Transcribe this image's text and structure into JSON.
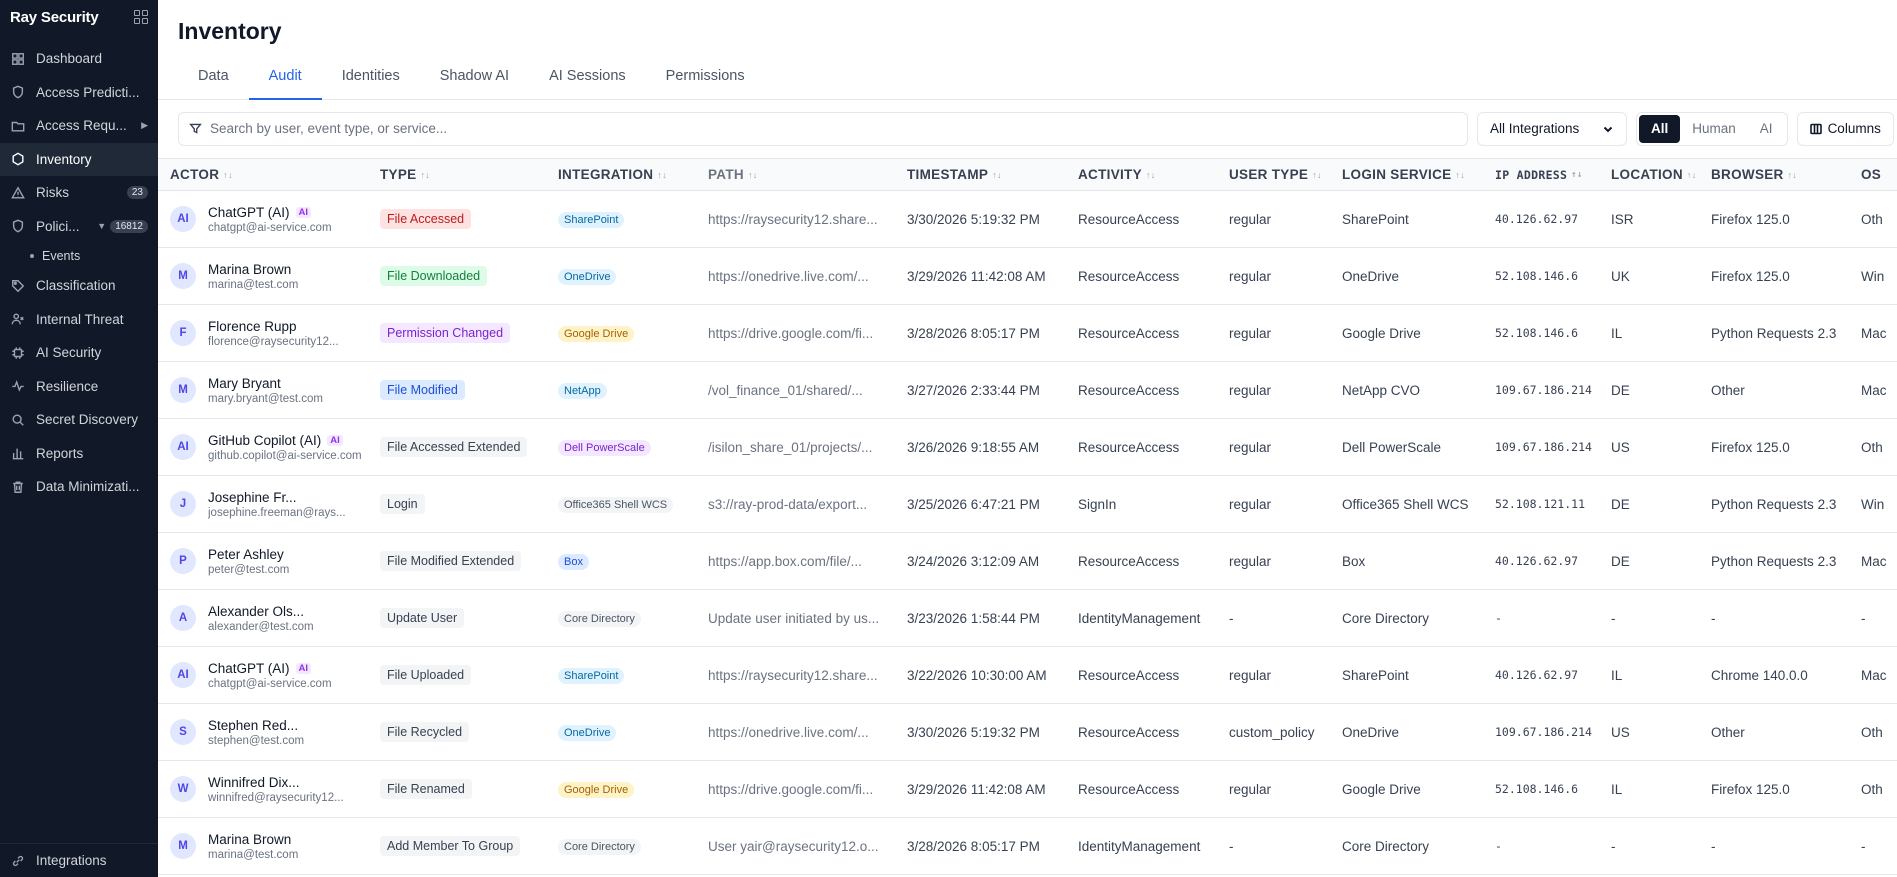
{
  "app": {
    "brand": "Ray Security"
  },
  "sidebar": {
    "items": [
      {
        "label": "Dashboard",
        "icon": "grid-icon"
      },
      {
        "label": "Access Predicti...",
        "icon": "shield-icon"
      },
      {
        "label": "Access Requ...",
        "icon": "folder-icon",
        "caret": "▶"
      },
      {
        "label": "Inventory",
        "icon": "hexagon-icon",
        "active": true
      },
      {
        "label": "Risks",
        "icon": "warning-icon",
        "badge": "23"
      },
      {
        "label": "Polici...",
        "icon": "shield-icon",
        "caret": "▼",
        "badge": "16812"
      },
      {
        "label": "Classification",
        "icon": "tag-icon"
      },
      {
        "label": "Internal Threat",
        "icon": "user-threat-icon"
      },
      {
        "label": "AI Security",
        "icon": "cpu-icon"
      },
      {
        "label": "Resilience",
        "icon": "pulse-icon"
      },
      {
        "label": "Secret Discovery",
        "icon": "search-icon"
      },
      {
        "label": "Reports",
        "icon": "bar-chart-icon"
      },
      {
        "label": "Data Minimizati...",
        "icon": "trash-icon"
      }
    ],
    "sub_item": "Events",
    "footer": "Integrations"
  },
  "page": {
    "title": "Inventory"
  },
  "tabs": [
    "Data",
    "Audit",
    "Identities",
    "Shadow AI",
    "AI Sessions",
    "Permissions"
  ],
  "active_tab": "Audit",
  "toolbar": {
    "search_placeholder": "Search by user, event type, or service...",
    "integration_select": "All Integrations",
    "segments": [
      "All",
      "Human",
      "AI"
    ],
    "active_segment": "All",
    "columns_label": "Columns"
  },
  "table": {
    "headers": [
      "ACTOR",
      "TYPE",
      "INTEGRATION",
      "PATH",
      "TIMESTAMP",
      "ACTIVITY",
      "USER TYPE",
      "LOGIN SERVICE",
      "IP ADDRESS",
      "LOCATION",
      "BROWSER",
      "OS"
    ],
    "rows": [
      {
        "avatar": "AI",
        "name": "ChatGPT (AI)",
        "ai": "AI",
        "email": "chatgpt@ai-service.com",
        "type": "File Accessed",
        "type_color": "red",
        "integration": "SharePoint",
        "int_color": "sharepoint",
        "path": "https://raysecurity12.share...",
        "timestamp": "3/30/2026 5:19:32 PM",
        "activity": "ResourceAccess",
        "user_type": "regular",
        "login": "SharePoint",
        "ip": "40.126.62.97",
        "location": "ISR",
        "browser": "Firefox 125.0",
        "os": "Oth"
      },
      {
        "avatar": "M",
        "name": "Marina Brown",
        "ai": "",
        "email": "marina@test.com",
        "type": "File Downloaded",
        "type_color": "green",
        "integration": "OneDrive",
        "int_color": "onedrive",
        "path": "https://onedrive.live.com/...",
        "timestamp": "3/29/2026 11:42:08 AM",
        "activity": "ResourceAccess",
        "user_type": "regular",
        "login": "OneDrive",
        "ip": "52.108.146.6",
        "location": "UK",
        "browser": "Firefox 125.0",
        "os": "Win"
      },
      {
        "avatar": "F",
        "name": "Florence Rupp",
        "ai": "",
        "email": "florence@raysecurity12...",
        "type": "Permission Changed",
        "type_color": "purple",
        "integration": "Google Drive",
        "int_color": "gdrive",
        "path": "https://drive.google.com/fi...",
        "timestamp": "3/28/2026 8:05:17 PM",
        "activity": "ResourceAccess",
        "user_type": "regular",
        "login": "Google Drive",
        "ip": "52.108.146.6",
        "location": "IL",
        "browser": "Python Requests 2.3",
        "os": "Mac"
      },
      {
        "avatar": "M",
        "name": "Mary Bryant",
        "ai": "",
        "email": "mary.bryant@test.com",
        "type": "File Modified",
        "type_color": "blue",
        "integration": "NetApp",
        "int_color": "netapp",
        "path": "/vol_finance_01/shared/...",
        "timestamp": "3/27/2026 2:33:44 PM",
        "activity": "ResourceAccess",
        "user_type": "regular",
        "login": "NetApp CVO",
        "ip": "109.67.186.214",
        "location": "DE",
        "browser": "Other",
        "os": "Mac"
      },
      {
        "avatar": "AI",
        "name": "GitHub Copilot (AI)",
        "ai": "AI",
        "email": "github.copilot@ai-service.com",
        "type": "File Accessed Extended",
        "type_color": "gray",
        "integration": "Dell PowerScale",
        "int_color": "dell",
        "path": "/isilon_share_01/projects/...",
        "timestamp": "3/26/2026 9:18:55 AM",
        "activity": "ResourceAccess",
        "user_type": "regular",
        "login": "Dell PowerScale",
        "ip": "109.67.186.214",
        "location": "US",
        "browser": "Firefox 125.0",
        "os": "Oth"
      },
      {
        "avatar": "J",
        "name": "Josephine Fr...",
        "ai": "",
        "email": "josephine.freeman@rays...",
        "type": "Login",
        "type_color": "gray",
        "integration": "Office365 Shell WCS",
        "int_color": "gray",
        "path": "s3://ray-prod-data/export...",
        "timestamp": "3/25/2026 6:47:21 PM",
        "activity": "SignIn",
        "user_type": "regular",
        "login": "Office365 Shell WCS",
        "ip": "52.108.121.11",
        "location": "DE",
        "browser": "Python Requests 2.3",
        "os": "Win"
      },
      {
        "avatar": "P",
        "name": "Peter Ashley",
        "ai": "",
        "email": "peter@test.com",
        "type": "File Modified Extended",
        "type_color": "gray",
        "integration": "Box",
        "int_color": "box",
        "path": "https://app.box.com/file/...",
        "timestamp": "3/24/2026 3:12:09 AM",
        "activity": "ResourceAccess",
        "user_type": "regular",
        "login": "Box",
        "ip": "40.126.62.97",
        "location": "DE",
        "browser": "Python Requests 2.3",
        "os": "Mac"
      },
      {
        "avatar": "A",
        "name": "Alexander Ols...",
        "ai": "",
        "email": "alexander@test.com",
        "type": "Update User",
        "type_color": "gray",
        "integration": "Core Directory",
        "int_color": "gray",
        "path": "Update user initiated by us...",
        "timestamp": "3/23/2026 1:58:44 PM",
        "activity": "IdentityManagement",
        "user_type": "-",
        "login": "Core Directory",
        "ip": "-",
        "location": "-",
        "browser": "-",
        "os": "-"
      },
      {
        "avatar": "AI",
        "name": "ChatGPT (AI)",
        "ai": "AI",
        "email": "chatgpt@ai-service.com",
        "type": "File Uploaded",
        "type_color": "gray",
        "integration": "SharePoint",
        "int_color": "sharepoint",
        "path": "https://raysecurity12.share...",
        "timestamp": "3/22/2026 10:30:00 AM",
        "activity": "ResourceAccess",
        "user_type": "regular",
        "login": "SharePoint",
        "ip": "40.126.62.97",
        "location": "IL",
        "browser": "Chrome 140.0.0",
        "os": "Mac"
      },
      {
        "avatar": "S",
        "name": "Stephen Red...",
        "ai": "",
        "email": "stephen@test.com",
        "type": "File Recycled",
        "type_color": "gray",
        "integration": "OneDrive",
        "int_color": "onedrive",
        "path": "https://onedrive.live.com/...",
        "timestamp": "3/30/2026 5:19:32 PM",
        "activity": "ResourceAccess",
        "user_type": "custom_policy",
        "login": "OneDrive",
        "ip": "109.67.186.214",
        "location": "US",
        "browser": "Other",
        "os": "Oth"
      },
      {
        "avatar": "W",
        "name": "Winnifred Dix...",
        "ai": "",
        "email": "winnifred@raysecurity12...",
        "type": "File Renamed",
        "type_color": "gray",
        "integration": "Google Drive",
        "int_color": "gdrive",
        "path": "https://drive.google.com/fi...",
        "timestamp": "3/29/2026 11:42:08 AM",
        "activity": "ResourceAccess",
        "user_type": "regular",
        "login": "Google Drive",
        "ip": "52.108.146.6",
        "location": "IL",
        "browser": "Firefox 125.0",
        "os": "Oth"
      },
      {
        "avatar": "M",
        "name": "Marina Brown",
        "ai": "",
        "email": "marina@test.com",
        "type": "Add Member To Group",
        "type_color": "gray",
        "integration": "Core Directory",
        "int_color": "gray",
        "path": "User yair@raysecurity12.o...",
        "timestamp": "3/28/2026 8:05:17 PM",
        "activity": "IdentityManagement",
        "user_type": "-",
        "login": "Core Directory",
        "ip": "-",
        "location": "-",
        "browser": "-",
        "os": "-"
      }
    ]
  }
}
